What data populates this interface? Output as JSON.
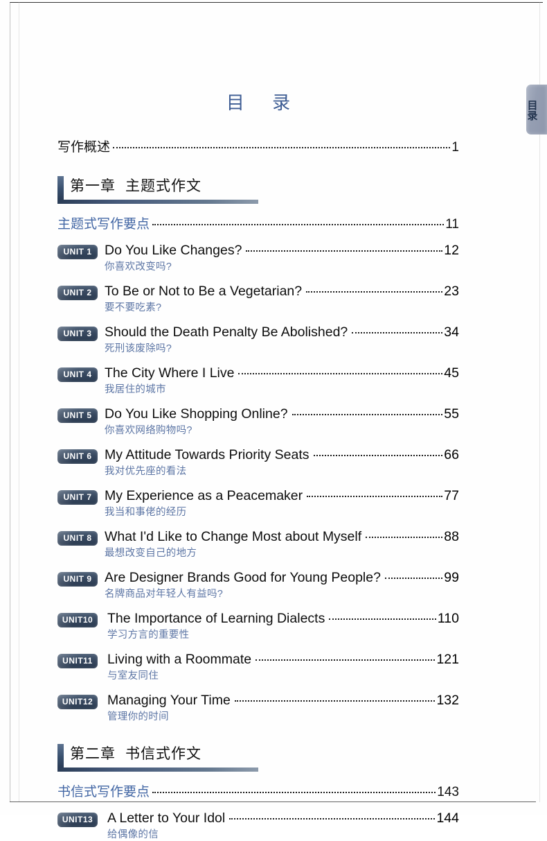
{
  "page": {
    "title": "目 录",
    "side_tab_label": "目录",
    "accent_blue": "#3d5c93",
    "link_blue": "#4266a4",
    "subtitle_blue": "#5d76a5",
    "badge_bg": "#37485f"
  },
  "preface": {
    "label": "写作概述",
    "page": "1"
  },
  "chapters": [
    {
      "heading_number": "第一章",
      "heading_title": "主题式作文",
      "keypoints": {
        "label": "主题式写作要点",
        "page": "11"
      },
      "units": [
        {
          "badge": "UNIT 1",
          "en": "Do You Like Changes?",
          "zh": "你喜欢改变吗?",
          "page": "12"
        },
        {
          "badge": "UNIT 2",
          "en": "To Be or Not to Be a Vegetarian?",
          "zh": "要不要吃素?",
          "page": "23"
        },
        {
          "badge": "UNIT 3",
          "en": "Should the Death Penalty Be Abolished?",
          "zh": "死刑该废除吗?",
          "page": "34"
        },
        {
          "badge": "UNIT 4",
          "en": "The City Where I Live",
          "zh": "我居住的城市",
          "page": "45"
        },
        {
          "badge": "UNIT 5",
          "en": "Do You Like Shopping Online?",
          "zh": "你喜欢网络购物吗?",
          "page": "55"
        },
        {
          "badge": "UNIT 6",
          "en": "My Attitude Towards Priority Seats",
          "zh": "我对优先座的看法",
          "page": "66"
        },
        {
          "badge": "UNIT 7",
          "en": "My Experience as a Peacemaker",
          "zh": "我当和事佬的经历",
          "page": "77"
        },
        {
          "badge": "UNIT 8",
          "en": "What I'd Like to Change Most about Myself",
          "zh": "最想改变自己的地方",
          "page": "88"
        },
        {
          "badge": "UNIT 9",
          "en": "Are Designer Brands Good for Young People?",
          "zh": "名牌商品对年轻人有益吗?",
          "page": "99"
        },
        {
          "badge": "UNIT10",
          "en": "The Importance of Learning Dialects",
          "zh": "学习方言的重要性",
          "page": "110"
        },
        {
          "badge": "UNIT11",
          "en": "Living with a Roommate",
          "zh": "与室友同住",
          "page": "121"
        },
        {
          "badge": "UNIT12",
          "en": "Managing Your Time",
          "zh": "管理你的时间",
          "page": "132"
        }
      ]
    },
    {
      "heading_number": "第二章",
      "heading_title": "书信式作文",
      "keypoints": {
        "label": "书信式写作要点",
        "page": "143"
      },
      "units": [
        {
          "badge": "UNIT13",
          "en": "A Letter to Your Idol",
          "zh": "给偶像的信",
          "page": "144"
        }
      ]
    }
  ]
}
